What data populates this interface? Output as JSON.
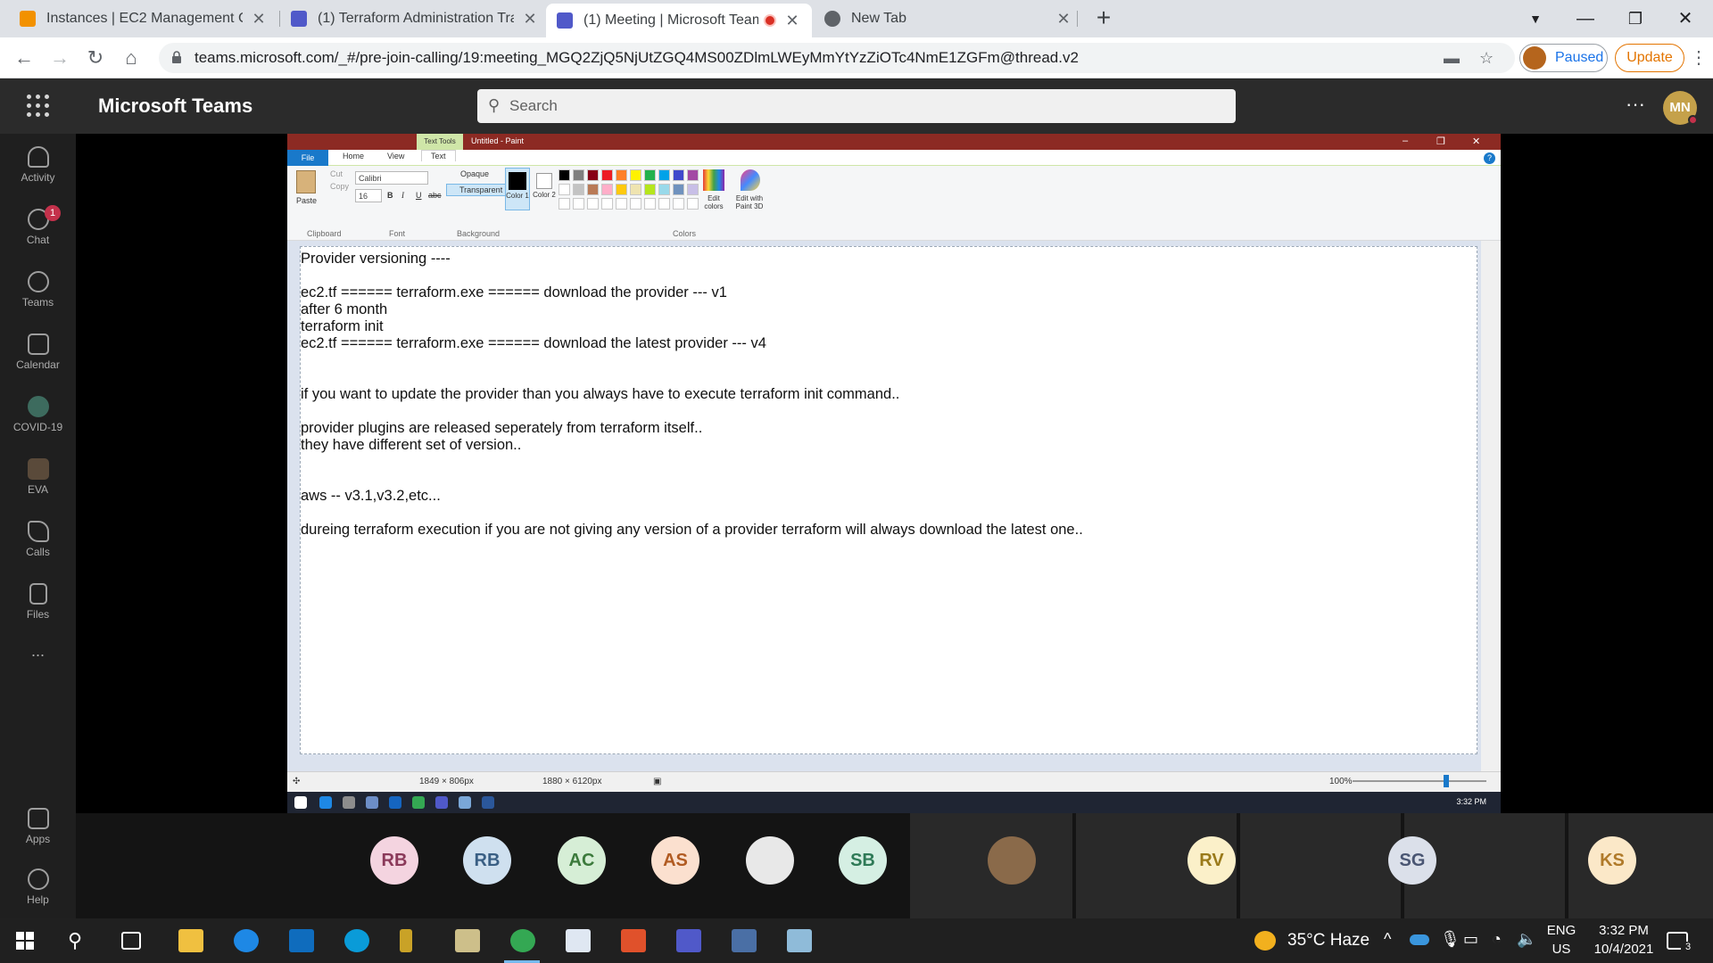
{
  "browser": {
    "tabs": [
      {
        "label": "Instances | EC2 Management Co",
        "active": false
      },
      {
        "label": "(1) Terraform Administration Trai",
        "active": false
      },
      {
        "label": "(1) Meeting | Microsoft Team",
        "active": true
      },
      {
        "label": "New Tab",
        "active": false
      }
    ],
    "new_tab": "+",
    "url": "teams.microsoft.com/_#/pre-join-calling/19:meeting_MGQ2ZjQ5NjUtZGQ4MS00ZDlmLWEyMmYtYzZiOTc4NmE1ZGFm@thread.v2",
    "profile_label": "Paused",
    "update_label": "Update"
  },
  "teams": {
    "app_title": "Microsoft Teams",
    "search_placeholder": "Search",
    "user_initials": "MN",
    "rail": [
      {
        "label": "Activity",
        "icon": "bell-icon"
      },
      {
        "label": "Chat",
        "icon": "chat-icon",
        "badge": "1"
      },
      {
        "label": "Teams",
        "icon": "teams-icon"
      },
      {
        "label": "Calendar",
        "icon": "calendar-icon"
      },
      {
        "label": "COVID-19",
        "icon": "covid-app-icon"
      },
      {
        "label": "EVA",
        "icon": "eva-app-icon"
      },
      {
        "label": "Calls",
        "icon": "phone-icon"
      },
      {
        "label": "Files",
        "icon": "file-icon"
      },
      {
        "label": "...",
        "icon": "more-icon"
      },
      {
        "label": "Apps",
        "icon": "apps-icon"
      },
      {
        "label": "Help",
        "icon": "help-icon"
      }
    ]
  },
  "paint": {
    "context_tab": "Text Tools",
    "title": "Untitled - Paint",
    "tabs": [
      "File",
      "Home",
      "View",
      "Text"
    ],
    "ribbon": {
      "paste": "Paste",
      "cut": "Cut",
      "copy": "Copy",
      "font_name": "Calibri",
      "font_size": "16",
      "opaque": "Opaque",
      "transparent": "Transparent",
      "color1": "Color 1",
      "color2": "Color 2",
      "edit_colors": "Edit colors",
      "edit_paint3d": "Edit with Paint 3D",
      "groups": [
        "Clipboard",
        "Font",
        "Background",
        "Colors"
      ]
    },
    "palette": [
      "#000000",
      "#7f7f7f",
      "#880015",
      "#ed1c24",
      "#ff7f27",
      "#fff200",
      "#22b14c",
      "#00a2e8",
      "#3f48cc",
      "#a349a4",
      "#ffffff",
      "#c3c3c3",
      "#b97a57",
      "#ffaec9",
      "#ffc90e",
      "#efe4b0",
      "#b5e61d",
      "#99d9ea",
      "#7092be",
      "#c8bfe7"
    ],
    "lines": [
      "Provider versioning ----",
      "",
      "ec2.tf ====== terraform.exe ====== download the provider --- v1",
      "after 6 month",
      "terraform init",
      "ec2.tf ====== terraform.exe ====== download the latest provider --- v4",
      "",
      "",
      "if you want to update the provider than you always have to execute terraform init command..",
      "",
      "provider plugins are released seperately from terraform itself..",
      "they have different set of version..",
      "",
      "",
      "aws -- v3.1,v3.2,etc...",
      "",
      "dureing terraform execution if you are not giving any version of a provider terraform will always download the latest one.."
    ],
    "status": {
      "selection": "1849 × 806px",
      "canvas_size": "1880 × 6120px",
      "zoom": "100%"
    },
    "mini_clock": "3:32 PM"
  },
  "participants": [
    {
      "initials": "RB",
      "bg": "#f4d4e0",
      "fg": "#8b3a5a"
    },
    {
      "initials": "RB",
      "bg": "#cfe0ef",
      "fg": "#3a5f84"
    },
    {
      "initials": "AC",
      "bg": "#d6eed6",
      "fg": "#3c7a3c"
    },
    {
      "initials": "AS",
      "bg": "#fbe0cf",
      "fg": "#b15b22"
    },
    {
      "initials": "",
      "bg": "#e8e8e8",
      "fg": "#333333",
      "photo": true
    },
    {
      "initials": "SB",
      "bg": "#d5efe3",
      "fg": "#2f7a57"
    },
    {
      "initials": "",
      "bg": "#8a6a4a",
      "fg": "#ffffff",
      "photo": true
    },
    {
      "initials": "RV",
      "bg": "#fbf0c9",
      "fg": "#9a7a1a"
    },
    {
      "initials": "SG",
      "bg": "#dbe0ea",
      "fg": "#4a5673"
    },
    {
      "initials": "KS",
      "bg": "#fbe8c8",
      "fg": "#b07a2a"
    }
  ],
  "taskbar": {
    "weather": "35°C Haze",
    "lang_top": "ENG",
    "lang_bottom": "US",
    "time": "3:32 PM",
    "date": "10/4/2021",
    "notifications": "3"
  }
}
